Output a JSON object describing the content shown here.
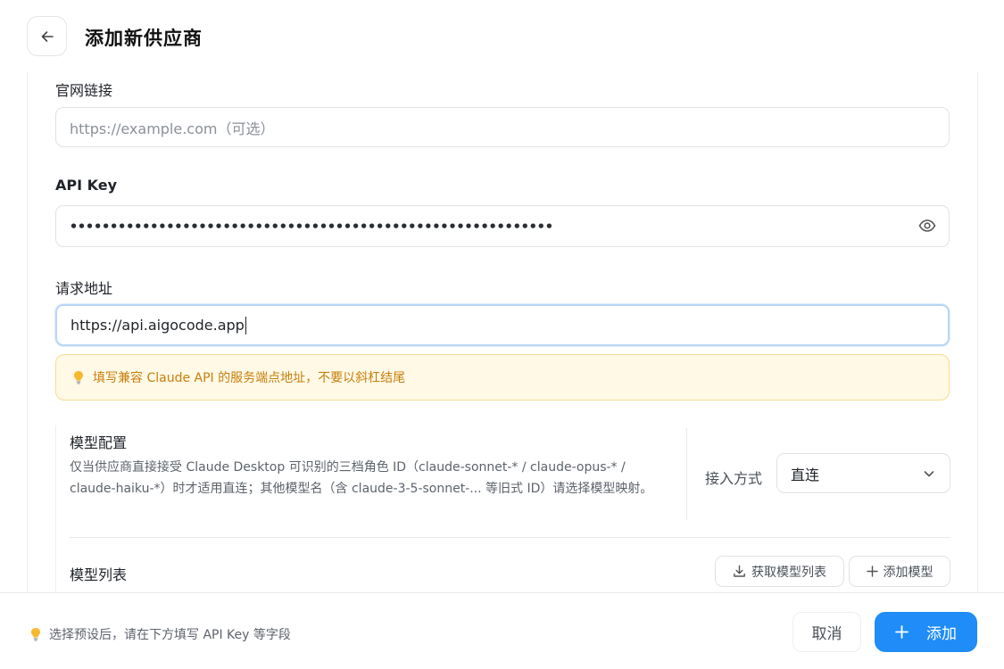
{
  "header": {
    "title": "添加新供应商",
    "back_icon": "arrow-left-icon"
  },
  "fields": {
    "website": {
      "label": "官网链接",
      "placeholder": "https://example.com（可选）",
      "value": ""
    },
    "api_key": {
      "label": "API Key",
      "masked_value": "••••••••••••••••••••••••••••••••••••••••••••••••••••••••••••",
      "toggle_icon": "eye-icon"
    },
    "request_url": {
      "label": "请求地址",
      "value": "https://api.aigocode.app"
    }
  },
  "hint": {
    "text": "填写兼容 Claude API 的服务端点地址，不要以斜杠结尾",
    "icon": "lightbulb-icon",
    "color": "#c77f0c"
  },
  "model_config": {
    "title": "模型配置",
    "description": "仅当供应商直接接受 Claude Desktop 可识别的三档角色 ID（claude-sonnet-* / claude-opus-* / claude-haiku-*）时才适用直连；其他模型名（含 claude-3-5-sonnet-... 等旧式 ID）请选择模型映射。",
    "access_label": "接入方式",
    "access_value": "直连"
  },
  "model_list": {
    "title": "模型列表",
    "fetch_button": "获取模型列表",
    "add_button": "添加模型"
  },
  "footer": {
    "hint": "选择预设后，请在下方填写 API Key 等字段",
    "cancel": "取消",
    "submit": "添加",
    "accent": "#1f8cf7"
  }
}
